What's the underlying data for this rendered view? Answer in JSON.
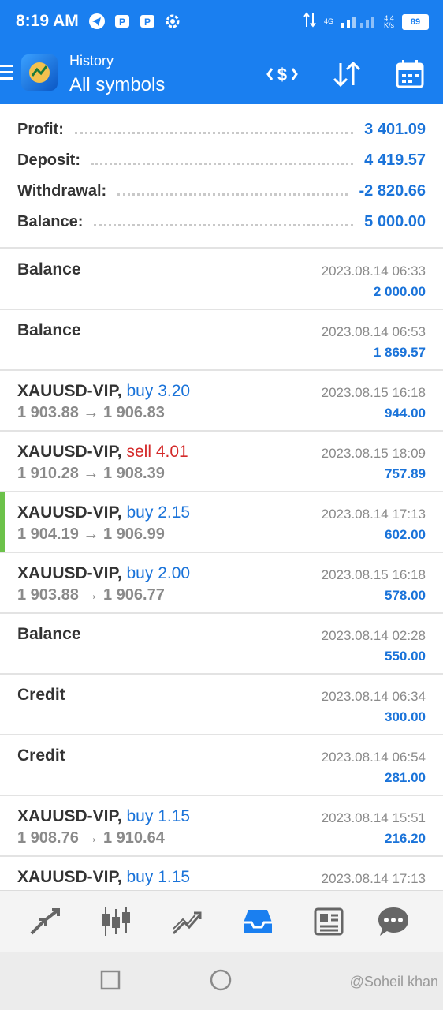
{
  "status_bar": {
    "time": "8:19 AM",
    "net_type": "4G",
    "speed_value": "4.4",
    "speed_unit": "K/s",
    "battery": "89"
  },
  "app_bar": {
    "subtitle": "History",
    "title": "All symbols"
  },
  "summary": [
    {
      "label": "Profit:",
      "value": "3 401.09"
    },
    {
      "label": "Deposit:",
      "value": "4 419.57"
    },
    {
      "label": "Withdrawal:",
      "value": "-2 820.66"
    },
    {
      "label": "Balance:",
      "value": "5 000.00"
    }
  ],
  "history": [
    {
      "title": "Balance",
      "side": "",
      "side_type": "",
      "prices": "",
      "date": "2023.08.14 06:33",
      "amount": "2 000.00"
    },
    {
      "title": "Balance",
      "side": "",
      "side_type": "",
      "prices": "",
      "date": "2023.08.14 06:53",
      "amount": "1 869.57"
    },
    {
      "title": "XAUUSD-VIP,",
      "side": "buy 3.20",
      "side_type": "buy",
      "prices": "1 903.88 → 1 906.83",
      "date": "2023.08.15 16:18",
      "amount": "944.00"
    },
    {
      "title": "XAUUSD-VIP,",
      "side": "sell 4.01",
      "side_type": "sell",
      "prices": "1 910.28 → 1 908.39",
      "date": "2023.08.15 18:09",
      "amount": "757.89"
    },
    {
      "title": "XAUUSD-VIP,",
      "side": "buy 2.15",
      "side_type": "buy",
      "prices": "1 904.19 → 1 906.99",
      "date": "2023.08.14 17:13",
      "amount": "602.00",
      "selected": true
    },
    {
      "title": "XAUUSD-VIP,",
      "side": "buy 2.00",
      "side_type": "buy",
      "prices": "1 903.88 → 1 906.77",
      "date": "2023.08.15 16:18",
      "amount": "578.00"
    },
    {
      "title": "Balance",
      "side": "",
      "side_type": "",
      "prices": "",
      "date": "2023.08.14 02:28",
      "amount": "550.00"
    },
    {
      "title": "Credit",
      "side": "",
      "side_type": "",
      "prices": "",
      "date": "2023.08.14 06:34",
      "amount": "300.00"
    },
    {
      "title": "Credit",
      "side": "",
      "side_type": "",
      "prices": "",
      "date": "2023.08.14 06:54",
      "amount": "281.00"
    },
    {
      "title": "XAUUSD-VIP,",
      "side": "buy 1.15",
      "side_type": "buy",
      "prices": "1 908.76 → 1 910.64",
      "date": "2023.08.14 15:51",
      "amount": "216.20"
    },
    {
      "title": "XAUUSD-VIP,",
      "side": "buy 1.15",
      "side_type": "buy",
      "prices": "",
      "date": "2023.08.14 17:13",
      "amount": ""
    }
  ],
  "bottom_nav": [
    "quotes-icon",
    "chart-icon",
    "trade-icon",
    "history-icon",
    "news-icon",
    "chat-icon"
  ],
  "watermark": "@Soheil khan",
  "colors": {
    "accent": "#1a7ff0",
    "positive": "#1a73d9",
    "sell": "#d42a2a",
    "selected_bar": "#6cc24a"
  }
}
